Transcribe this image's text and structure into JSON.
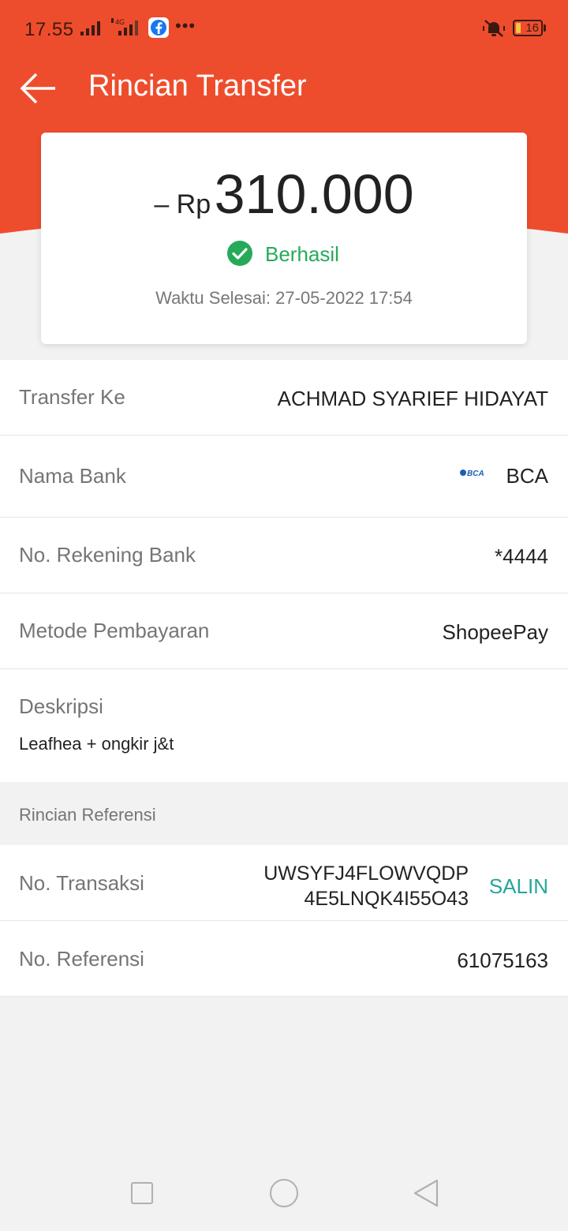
{
  "status_bar": {
    "time": "17.55",
    "network_type": "4G",
    "battery_level": "16",
    "icons": [
      "signal-icon",
      "signal-4g-icon",
      "facebook-icon",
      "more-dots-icon",
      "silent-mode-icon",
      "battery-icon"
    ]
  },
  "header": {
    "title": "Rincian Transfer",
    "back_icon": "arrow-left-icon",
    "color": "#ee4d2d"
  },
  "summary": {
    "amount_prefix": "– Rp",
    "amount": "310.000",
    "status": "Berhasil",
    "status_color": "#26aa5a",
    "finish_time": "Waktu Selesai: 27-05-2022 17:54"
  },
  "details": {
    "transfer_to": {
      "label": "Transfer Ke",
      "value": "ACHMAD SYARIEF HIDAYAT"
    },
    "bank_name": {
      "label": "Nama Bank",
      "value": "BCA",
      "logo_text": "BCA"
    },
    "account_number": {
      "label": "No. Rekening Bank",
      "value": "*4444"
    },
    "payment_method": {
      "label": "Metode Pembayaran",
      "value": "ShopeePay"
    },
    "description": {
      "label": "Deskripsi",
      "value": "Leafhea + ongkir j&t"
    }
  },
  "reference": {
    "section_title": "Rincian Referensi",
    "transaction_no": {
      "label": "No. Transaksi",
      "value_line1": "UWSYFJ4FLOWVQDP",
      "value_line2": "4E5LNQK4I55O43",
      "copy_label": "SALIN"
    },
    "reference_no": {
      "label": "No. Referensi",
      "value": "61075163"
    }
  },
  "nav_bar": {
    "icons": [
      "recent-apps-icon",
      "home-icon",
      "back-icon"
    ]
  }
}
